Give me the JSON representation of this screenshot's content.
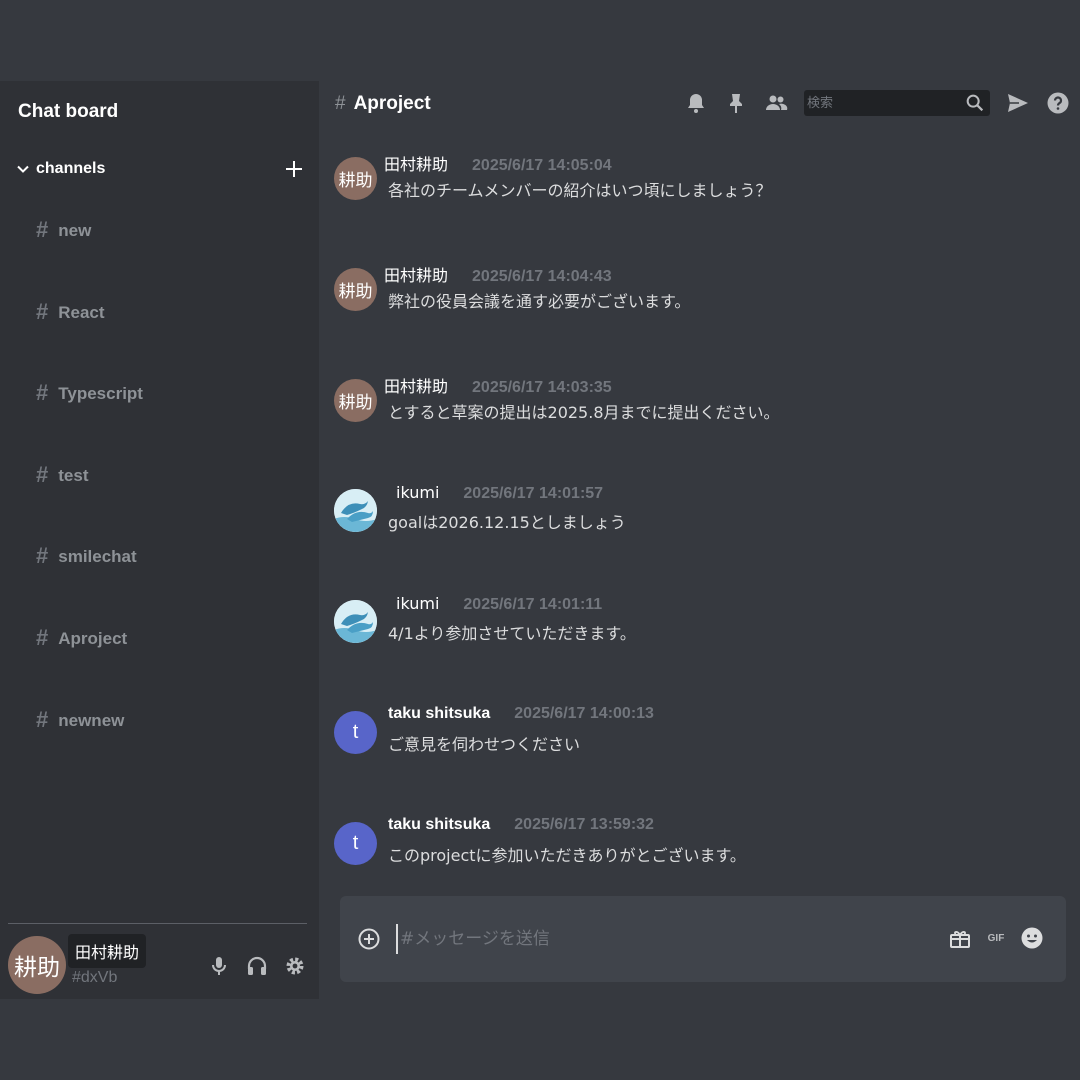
{
  "sidebar": {
    "title": "Chat board",
    "channels_label": "channels",
    "channels": [
      {
        "name": "new"
      },
      {
        "name": "React"
      },
      {
        "name": "Typescript"
      },
      {
        "name": "test"
      },
      {
        "name": "smilechat"
      },
      {
        "name": "Aproject"
      },
      {
        "name": "newnew"
      }
    ],
    "user": {
      "avatar_text": "耕助",
      "name": "田村耕助",
      "tag": "#dxVb"
    }
  },
  "header": {
    "hash": "#",
    "channel_name": "Aproject",
    "search_placeholder": "検索"
  },
  "messages": [
    {
      "avatar_type": "kanji",
      "avatar_text": "耕助",
      "author": "田村耕助",
      "time": "2025/6/17 14:05:04",
      "text": "各社のチームメンバーの紹介はいつ頃にしましょう？"
    },
    {
      "avatar_type": "kanji",
      "avatar_text": "耕助",
      "author": "田村耕助",
      "time": "2025/6/17 14:04:43",
      "text": "弊社の役員会議を通す必要がございます。"
    },
    {
      "avatar_type": "kanji",
      "avatar_text": "耕助",
      "author": "田村耕助",
      "time": "2025/6/17 14:03:35",
      "text": "とすると草案の提出は2025.8月までに提出ください。"
    },
    {
      "avatar_type": "photo",
      "avatar_text": "",
      "author": "ikumi",
      "time": "2025/6/17 14:01:57",
      "text": "goalは2026.12.15としましょう"
    },
    {
      "avatar_type": "photo",
      "avatar_text": "",
      "author": "ikumi",
      "time": "2025/6/17 14:01:11",
      "text": "4/1より参加させていただきます。"
    },
    {
      "avatar_type": "letter",
      "avatar_text": "t",
      "author": "taku shitsuka",
      "time": "2025/6/17 14:00:13",
      "text": "ご意見を伺わせつください"
    },
    {
      "avatar_type": "letter",
      "avatar_text": "t",
      "author": "taku shitsuka",
      "time": "2025/6/17 13:59:32",
      "text": "このprojectに参加いただきありがとございます。"
    }
  ],
  "composer": {
    "placeholder": "#メッセージを送信",
    "gif_label": "GIF"
  },
  "colors": {
    "app_bg": "#36393f",
    "sidebar_bg": "#2f3136",
    "kanji_avatar": "#8a6d62",
    "letter_avatar": "#5865c9"
  },
  "icons": {
    "header": [
      "bell-icon",
      "pin-icon",
      "members-icon",
      "search-icon",
      "send-icon",
      "help-icon"
    ],
    "user_controls": [
      "mic-icon",
      "headphones-icon",
      "settings-gear-icon"
    ],
    "composer": [
      "add-circle-icon",
      "gift-icon",
      "gif-icon",
      "emoji-icon"
    ]
  }
}
